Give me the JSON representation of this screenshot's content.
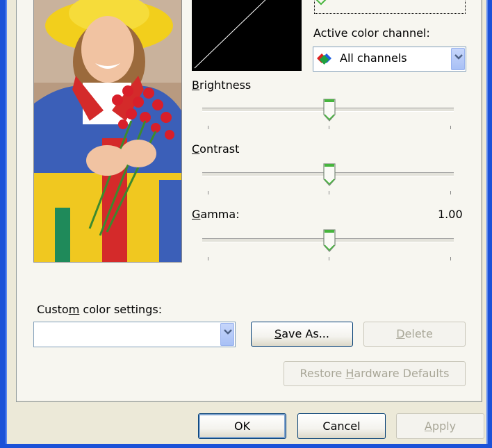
{
  "color_channel": {
    "label": "Active color channel:",
    "selected": "All channels",
    "icon": "rgb-color-channels-icon"
  },
  "sliders": {
    "brightness": {
      "label": "Brightness",
      "level": 0.5
    },
    "contrast": {
      "label": "Contrast",
      "level": 0.5
    },
    "gamma": {
      "label": "Gamma:",
      "value": "1.00",
      "level": 0.5
    }
  },
  "custom": {
    "label": "Custom color settings:",
    "value": "",
    "save_as": "Save As...",
    "delete": "Delete",
    "restore": "Restore Hardware Defaults"
  },
  "dialog_buttons": {
    "ok": "OK",
    "cancel": "Cancel",
    "apply": "Apply"
  },
  "colors": {
    "accent": "#1b52d8",
    "thumb": "#46b53d",
    "dialog_bg": "#ece9d8"
  }
}
